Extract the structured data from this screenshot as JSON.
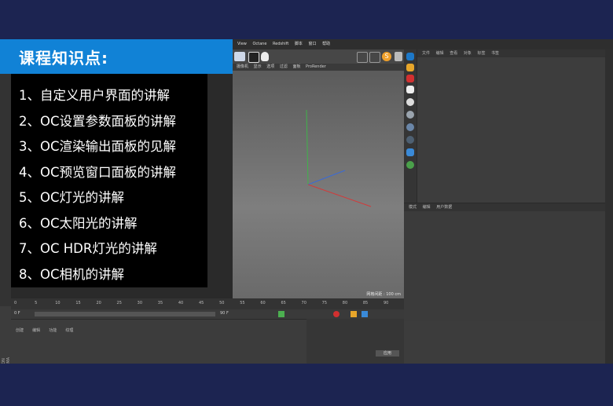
{
  "overlay": {
    "title": "课程知识点:",
    "items": [
      "1、自定义用户界面的讲解",
      "2、OC设置参数面板的讲解",
      "3、OC渲染输出面板的见解",
      "4、OC预览窗口面板的讲解",
      "5、OC灯光的讲解",
      "6、OC太阳光的讲解",
      "7、OC HDR灯光的讲解",
      "8、OC相机的讲解"
    ]
  },
  "app": {
    "menu": [
      "View",
      "Octane",
      "Redshift",
      "脚本",
      "窗口",
      "帮助"
    ],
    "viewport_menu": [
      "摄像机",
      "显示",
      "选项",
      "过滤",
      "面板",
      "ProRender"
    ],
    "viewport_info": "网格间距 : 100 cm",
    "object_manager_menu": [
      "文件",
      "编辑",
      "查看",
      "对象",
      "标签",
      "书签"
    ],
    "attribute_manager_menu": [
      "模式",
      "编辑",
      "用户数据"
    ],
    "material_manager_menu": [
      "创建",
      "编辑",
      "功能",
      "纹理"
    ],
    "timeline_ticks": [
      "0",
      "5",
      "10",
      "15",
      "20",
      "25",
      "30",
      "35",
      "40",
      "45",
      "50",
      "55",
      "60",
      "65",
      "70",
      "75",
      "80",
      "85",
      "90"
    ],
    "frame_start": "0 F",
    "frame_end": "90 F",
    "coords_apply": "应用",
    "brand_vertical": "MAXON CINEMA 4D",
    "colors": {
      "title_bar": "#1182d6",
      "background": "#1c2451",
      "axis_x": "#d23a3a",
      "axis_y": "#3fb44a",
      "axis_z": "#3a6ad6"
    }
  }
}
